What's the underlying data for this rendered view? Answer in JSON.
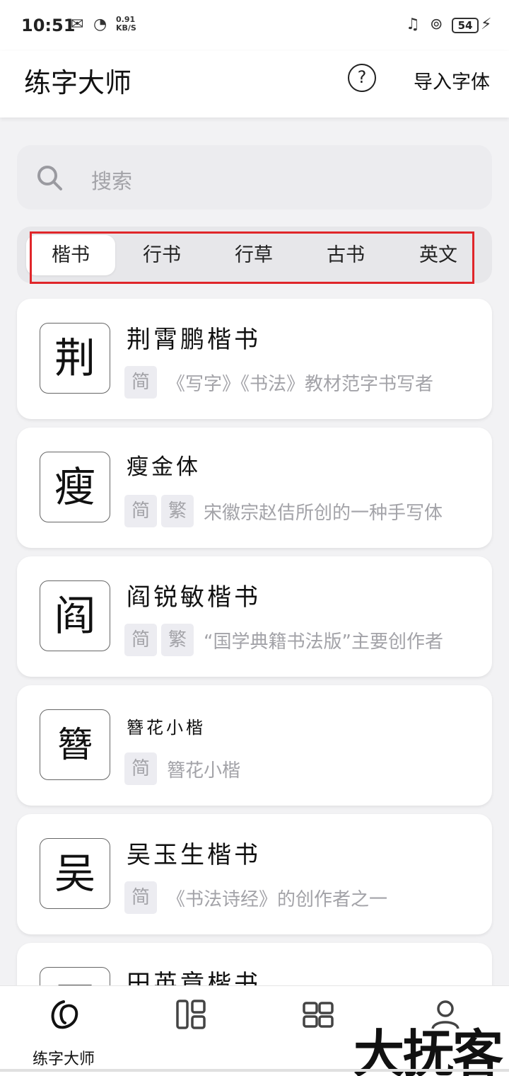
{
  "status_bar": {
    "time": "10:51",
    "net_speed_value": "0.91",
    "net_speed_unit": "KB/S",
    "battery": "54"
  },
  "app_bar": {
    "title": "练字大师",
    "help_icon": "question-circle-icon",
    "import_label": "导入字体"
  },
  "search": {
    "placeholder": "搜索"
  },
  "tabs": [
    {
      "label": "楷书",
      "active": true
    },
    {
      "label": "行书",
      "active": false
    },
    {
      "label": "行草",
      "active": false
    },
    {
      "label": "古书",
      "active": false
    },
    {
      "label": "英文",
      "active": false
    }
  ],
  "fonts": [
    {
      "char": "荆",
      "name": "荆霄鹏楷书",
      "tags": [
        "简"
      ],
      "desc": "《写字》《书法》教材范字书写者"
    },
    {
      "char": "瘦",
      "name": "瘦金体",
      "tags": [
        "简",
        "繁"
      ],
      "desc": "宋徽宗赵佶所创的一种手写体"
    },
    {
      "char": "阎",
      "name": "阎锐敏楷书",
      "tags": [
        "简",
        "繁"
      ],
      "desc": "“国学典籍书法版”主要创作者"
    },
    {
      "char": "簪",
      "name": "簪花小楷",
      "tags": [
        "简"
      ],
      "desc": "簪花小楷"
    },
    {
      "char": "吴",
      "name": "吴玉生楷书",
      "tags": [
        "简"
      ],
      "desc": "《书法诗经》的创作者之一"
    },
    {
      "char": "田",
      "name": "田英章楷书",
      "tags": [],
      "desc": ""
    }
  ],
  "bottom_nav": [
    {
      "label": "练字大师",
      "icon": "brush-logo-icon"
    },
    {
      "label": "",
      "icon": "layout-icon"
    },
    {
      "label": "",
      "icon": "grid-icon"
    },
    {
      "label": "",
      "icon": "profile-icon"
    }
  ],
  "watermark": "大抚客",
  "colors": {
    "accent_highlight": "#e0262a",
    "muted_text": "#a3a3a8",
    "background": "#f2f2f4"
  }
}
